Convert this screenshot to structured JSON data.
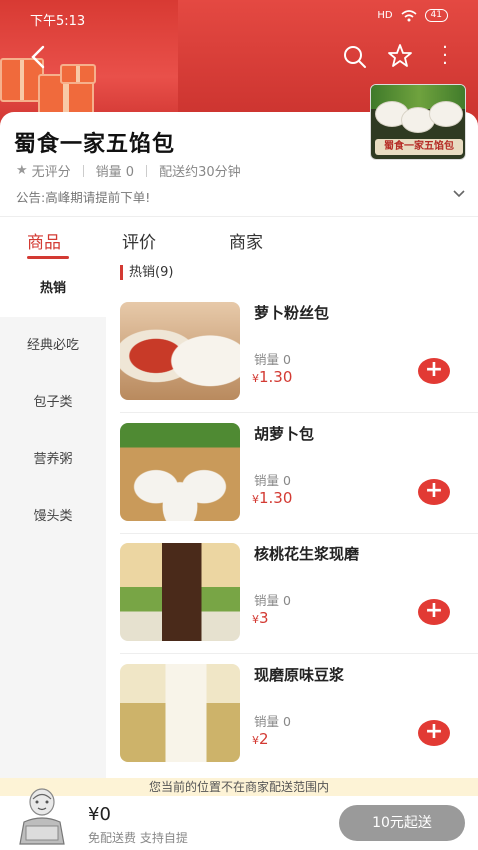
{
  "status_bar": {
    "time": "下午5:13",
    "signal": "HD",
    "battery": "41"
  },
  "shop": {
    "name": "蜀食一家五馅包",
    "logo_text": "蜀食一家五馅包",
    "rating": "无评分",
    "sales": "销量 0",
    "delivery": "配送约30分钟",
    "notice": "公告:高峰期请提前下单!"
  },
  "tabs": [
    {
      "label": "商品"
    },
    {
      "label": "评价"
    },
    {
      "label": "商家"
    }
  ],
  "categories": [
    {
      "label": "热销"
    },
    {
      "label": "经典必吃"
    },
    {
      "label": "包子类"
    },
    {
      "label": "营养粥"
    },
    {
      "label": "馒头类"
    }
  ],
  "section_title": "热销(9)",
  "products": [
    {
      "name": "萝卜粉丝包",
      "sales": "销量 0",
      "currency": "¥",
      "price": "1.30",
      "image": "radish-vermicelli-bun-photo"
    },
    {
      "name": "胡萝卜包",
      "sales": "销量 0",
      "currency": "¥",
      "price": "1.30",
      "image": "carrot-bun-photo"
    },
    {
      "name": "核桃花生浆现磨",
      "sales": "销量 0",
      "currency": "¥",
      "price": "3",
      "image": "walnut-peanut-drink-photo"
    },
    {
      "name": "现磨原味豆浆",
      "sales": "销量 0",
      "currency": "¥",
      "price": "2",
      "image": "soy-milk-photo"
    }
  ],
  "footer": {
    "range_tip": "您当前的位置不在商家配送范围内",
    "total": "¥0",
    "fee": "免配送费  支持自提",
    "checkout": "10元起送"
  },
  "colors": {
    "accent": "#d33a33",
    "banner": "#e44942",
    "checkout_disabled": "#9a9a9a"
  }
}
